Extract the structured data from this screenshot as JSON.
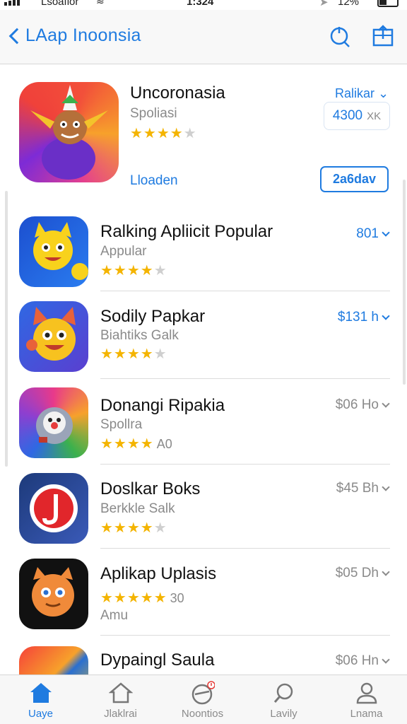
{
  "status_bar": {
    "carrier": "Lsoaflor",
    "time": "1:324",
    "battery": "12%"
  },
  "nav": {
    "back_label": "LAap Inoonsia"
  },
  "featured": {
    "name": "Uncoronasia",
    "subtitle": "Spoliasi",
    "rating_label": "Ralikar",
    "price": "4300",
    "price_unit": "XK",
    "link": "Lloaden",
    "button": "2a6dav",
    "stars": 4
  },
  "apps": [
    {
      "name": "Ralking Apliicit Popular",
      "subtitle": "Appular",
      "stars": 4,
      "price": "801",
      "price_color": "#1f7be0"
    },
    {
      "name": "Sodily Papkar",
      "subtitle": "Biahtiks Galk",
      "stars": 4,
      "price": "$131 h",
      "price_color": "#1f7be0"
    },
    {
      "name": "Donangi Ripakia",
      "subtitle": "Spollra",
      "stars": 4,
      "extra": "A0",
      "price": "$06 Ho",
      "price_color": "#8a8a8a"
    },
    {
      "name": "Doslkar Boks",
      "subtitle": "Berkkle Salk",
      "stars": 4,
      "price": "$45 Bh",
      "price_color": "#8a8a8a"
    },
    {
      "name": "Aplikap Uplasis",
      "subtitle": "Amu",
      "stars": 5,
      "extra": "30",
      "price": "$05 Dh",
      "price_color": "#8a8a8a"
    },
    {
      "name": "Dypaingl Saula",
      "subtitle": "",
      "stars": 0,
      "price": "$06 Hn",
      "price_color": "#8a8a8a"
    }
  ],
  "tabs": [
    {
      "label": "Uaye",
      "icon": "home-icon",
      "active": true
    },
    {
      "label": "Jlaklrai",
      "icon": "house-outline-icon",
      "active": false
    },
    {
      "label": "Noontios",
      "icon": "notifications-icon",
      "active": false
    },
    {
      "label": "Lavily",
      "icon": "search-icon",
      "active": false
    },
    {
      "label": "Lnama",
      "icon": "person-icon",
      "active": false
    }
  ],
  "colors": {
    "accent": "#1f7be0",
    "star": "#f4b400"
  }
}
